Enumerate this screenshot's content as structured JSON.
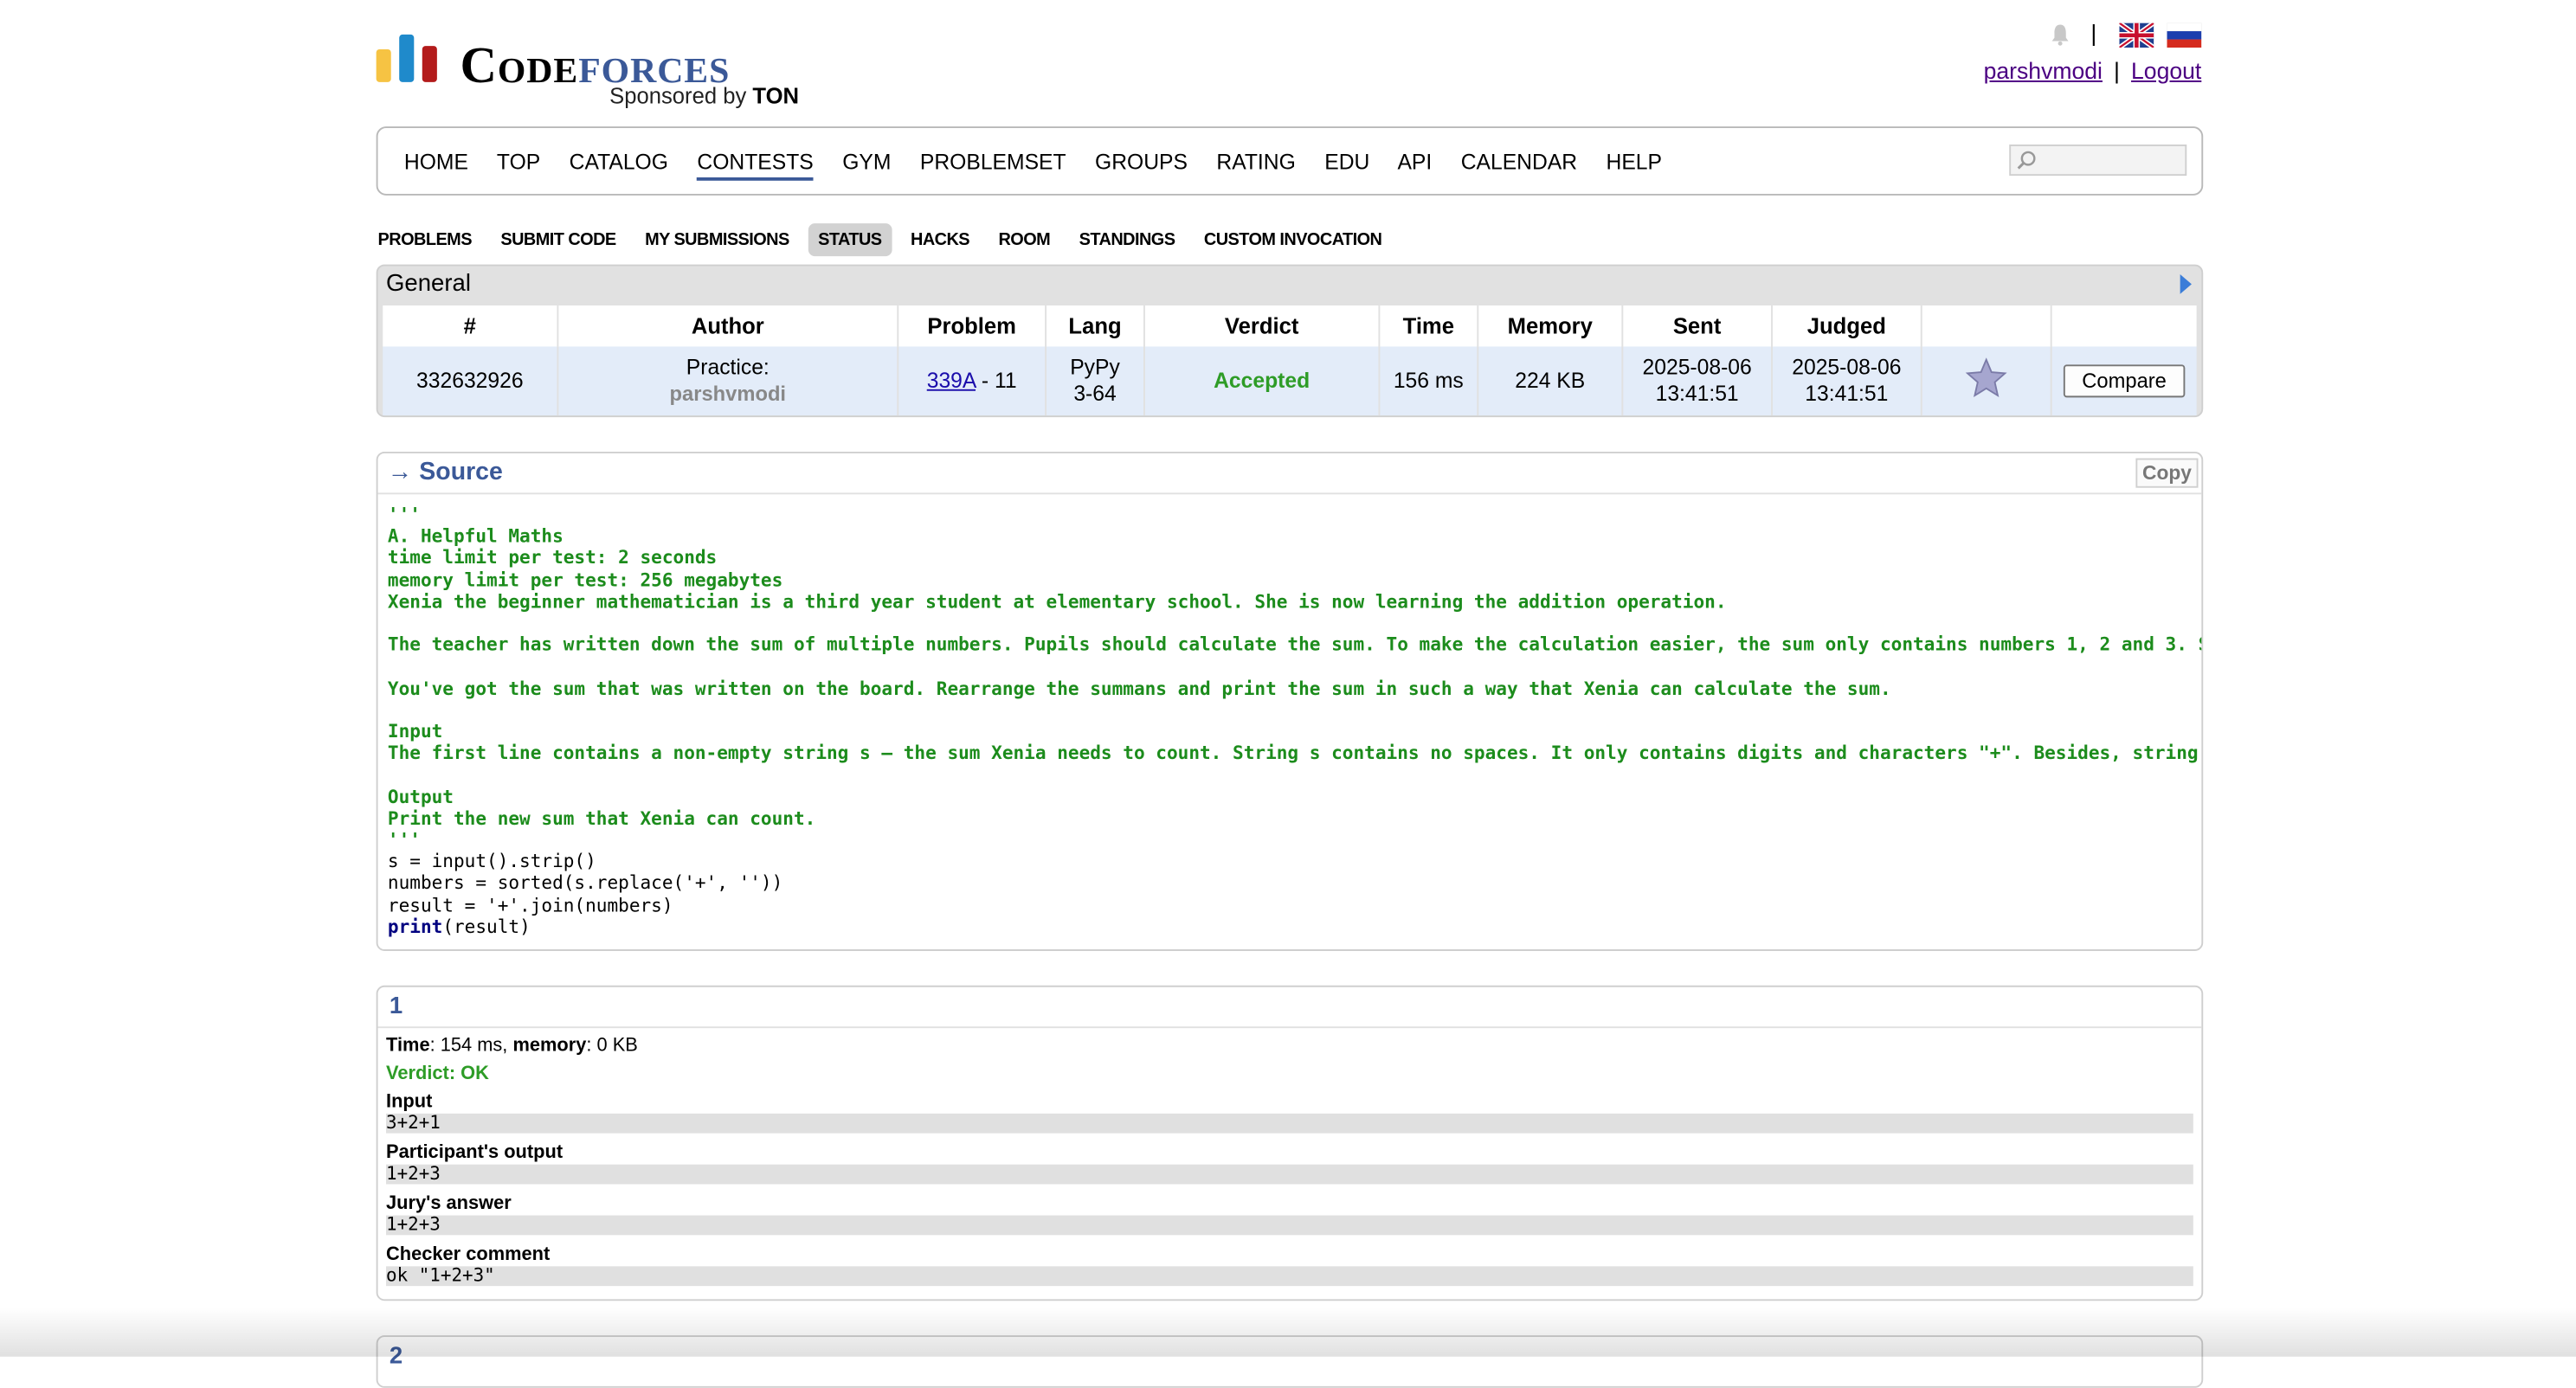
{
  "header": {
    "logo_code": "Code",
    "logo_forces": "forces",
    "sponsor_prefix": "Sponsored by",
    "sponsor_name": "TON",
    "separator": "|",
    "username": "parshvmodi",
    "logout": "Logout"
  },
  "menu": [
    "HOME",
    "TOP",
    "CATALOG",
    "CONTESTS",
    "GYM",
    "PROBLEMSET",
    "GROUPS",
    "RATING",
    "EDU",
    "API",
    "CALENDAR",
    "HELP"
  ],
  "sub_menu": [
    "PROBLEMS",
    "SUBMIT CODE",
    "MY SUBMISSIONS",
    "STATUS",
    "HACKS",
    "ROOM",
    "STANDINGS",
    "CUSTOM INVOCATION"
  ],
  "status": {
    "title": "General",
    "headers": [
      "#",
      "Author",
      "Problem",
      "Lang",
      "Verdict",
      "Time",
      "Memory",
      "Sent",
      "Judged"
    ],
    "row": {
      "id": "332632926",
      "author_prefix": "Practice:",
      "author_name": "parshvmodi",
      "problem_link": "339A",
      "problem_suffix": " - 11",
      "lang_1": "PyPy",
      "lang_2": "3-64",
      "verdict": "Accepted",
      "time": "156 ms",
      "memory": "224 KB",
      "sent_date": "2025-08-06",
      "sent_time": "13:41:51",
      "judged_date": "2025-08-06",
      "judged_time": "13:41:51",
      "compare": "Compare"
    }
  },
  "source": {
    "title": "→ Source",
    "copy": "Copy",
    "comment_lines": [
      "'''",
      "A. Helpful Maths",
      "time limit per test: 2 seconds",
      "memory limit per test: 256 megabytes",
      "Xenia the beginner mathematician is a third year student at elementary school. She is now learning the addition operation.",
      "",
      "The teacher has written down the sum of multiple numbers. Pupils should calculate the sum. To make the calculation easier, the sum only contains numbers 1, 2 and 3. Still, that isn't enough for",
      "",
      "You've got the sum that was written on the board. Rearrange the summans and print the sum in such a way that Xenia can calculate the sum.",
      "",
      "Input",
      "The first line contains a non-empty string s — the sum Xenia needs to count. String s contains no spaces. It only contains digits and characters \"+\". Besides, string s is a correct sum of numbe",
      "",
      "Output",
      "Print the new sum that Xenia can count.",
      "'''"
    ],
    "code_line_1": "s = input().strip()",
    "code_line_2": "numbers = sorted(s.replace('+', ''))",
    "code_line_3": "result = '+'.join(numbers)",
    "code_line_4_kw": "print",
    "code_line_4_rest": "(result)"
  },
  "test": {
    "number": "1",
    "time_label": "Time",
    "time_value": ": 154 ms, ",
    "memory_label": "memory",
    "memory_value": ": 0 KB",
    "verdict": "Verdict: OK",
    "input_label": "Input",
    "input_value": "3+2+1",
    "output_label": "Participant's output",
    "output_value": "1+2+3",
    "answer_label": "Jury's answer",
    "answer_value": "1+2+3",
    "checker_label": "Checker comment",
    "checker_value": "ok \"1+2+3\""
  },
  "next_test": {
    "number": "2"
  },
  "colors": {
    "accent": "#3b5998",
    "accepted": "#2e9c27",
    "row_bg": "#e3ecf9"
  }
}
